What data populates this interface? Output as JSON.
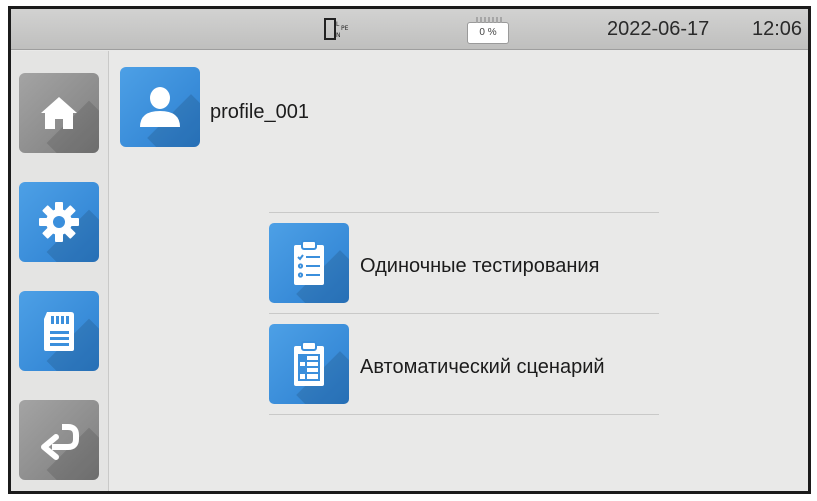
{
  "status_bar": {
    "connection_icon": "plug-connection-icon",
    "storage_icon": "sd-card-usage-icon",
    "storage_percent": "0 %",
    "date": "2022-06-17",
    "time": "12:06"
  },
  "sidebar": {
    "items": [
      {
        "id": "home",
        "icon": "home-icon"
      },
      {
        "id": "settings",
        "icon": "gear-icon"
      },
      {
        "id": "memory",
        "icon": "sd-card-icon"
      },
      {
        "id": "back",
        "icon": "return-arrow-icon"
      }
    ]
  },
  "profile": {
    "icon": "user-icon",
    "name": "profile_001"
  },
  "menu": {
    "items": [
      {
        "label": "Одиночные тестирования",
        "icon": "checklist-clipboard-icon"
      },
      {
        "label": "Автоматический сценарий",
        "icon": "table-clipboard-icon"
      }
    ]
  },
  "colors": {
    "accent_blue": "#2c7fd0",
    "button_grey": "#8c8c8c",
    "background": "#e9e9e8",
    "status_bar": "#c8c8c7"
  }
}
